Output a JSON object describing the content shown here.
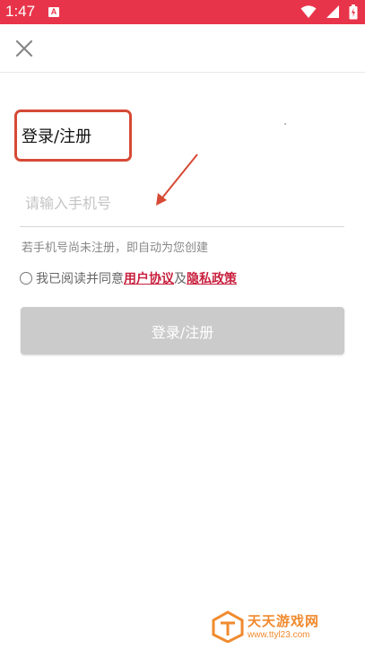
{
  "status_bar": {
    "time": "1:47",
    "notification_icon": "A",
    "icons": [
      "wifi-icon",
      "signal-icon",
      "battery-icon"
    ],
    "bg_color": "#e8344a"
  },
  "header": {
    "close_icon": "close-icon"
  },
  "form": {
    "title": "登录/注册",
    "phone_placeholder": "请输入手机号",
    "phone_value": "",
    "hint": "若手机号尚未注册，即自动为您创建",
    "agreement": {
      "prefix": "我已阅读并同意",
      "user_agreement": "用户协议",
      "conjunction": "及",
      "privacy_policy": "隐私政策",
      "checked": false
    },
    "submit_label": "登录/注册",
    "submit_enabled": false
  },
  "watermark": {
    "name": "天天游戏网",
    "url": "www.ttyl23.com"
  },
  "colors": {
    "accent": "#c8213f",
    "annotation": "#d64a35",
    "button_disabled": "#cbcbcb"
  }
}
